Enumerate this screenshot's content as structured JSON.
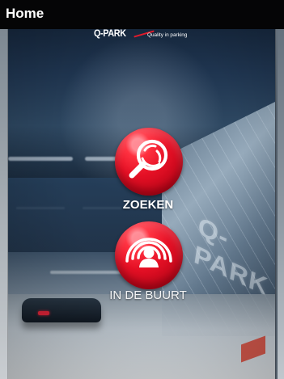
{
  "screen": {
    "title": "Home"
  },
  "brand": {
    "name": "Q-PARK",
    "tagline": "Quality in parking"
  },
  "background": {
    "wall_sign": "Q-PARK"
  },
  "actions": [
    {
      "label": "ZOEKEN",
      "icon": "search-icon"
    },
    {
      "label": "IN DE BUURT",
      "icon": "nearby-location-icon"
    }
  ],
  "colors": {
    "brand_red": "#e51025",
    "top_bar": "#050506",
    "text": "#ffffff"
  }
}
